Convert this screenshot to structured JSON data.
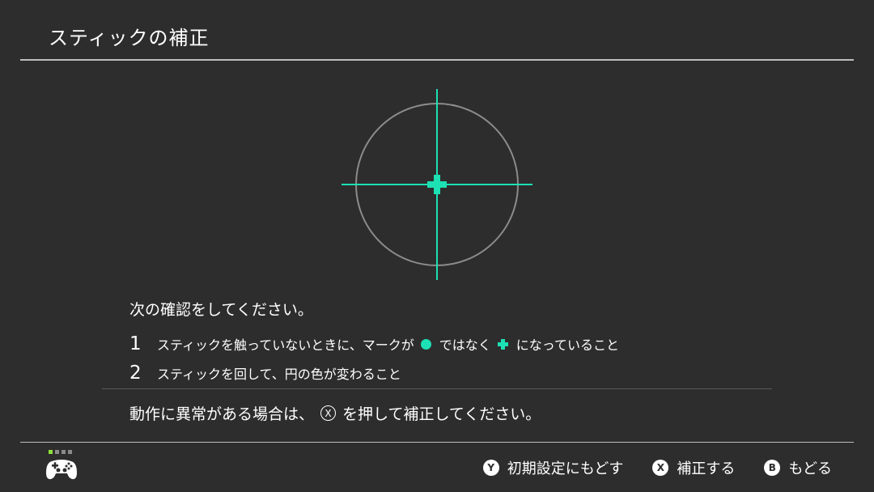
{
  "title": "スティックの補正",
  "colors": {
    "accent": "#1de0b4",
    "background": "#2d2d2d",
    "player_indicator": "#8ee03a"
  },
  "instructions": {
    "heading": "次の確認をしてください。",
    "steps": [
      {
        "number": "1",
        "text_before": "スティックを触っていないときに、マークが",
        "text_middle": "ではなく",
        "text_after": "になっていること"
      },
      {
        "number": "2",
        "text": "スティックを回して、円の色が変わること"
      }
    ]
  },
  "note": {
    "before": "動作に異常がある場合は、",
    "button": "X",
    "after": "を押して補正してください。"
  },
  "footer": {
    "buttons": [
      {
        "key": "Y",
        "label": "初期設定にもどす"
      },
      {
        "key": "X",
        "label": "補正する"
      },
      {
        "key": "B",
        "label": "もどる"
      }
    ]
  },
  "icons": {
    "controller": "pro-controller-icon",
    "neutral_mark": "dot-icon",
    "target_mark": "plus-icon"
  }
}
